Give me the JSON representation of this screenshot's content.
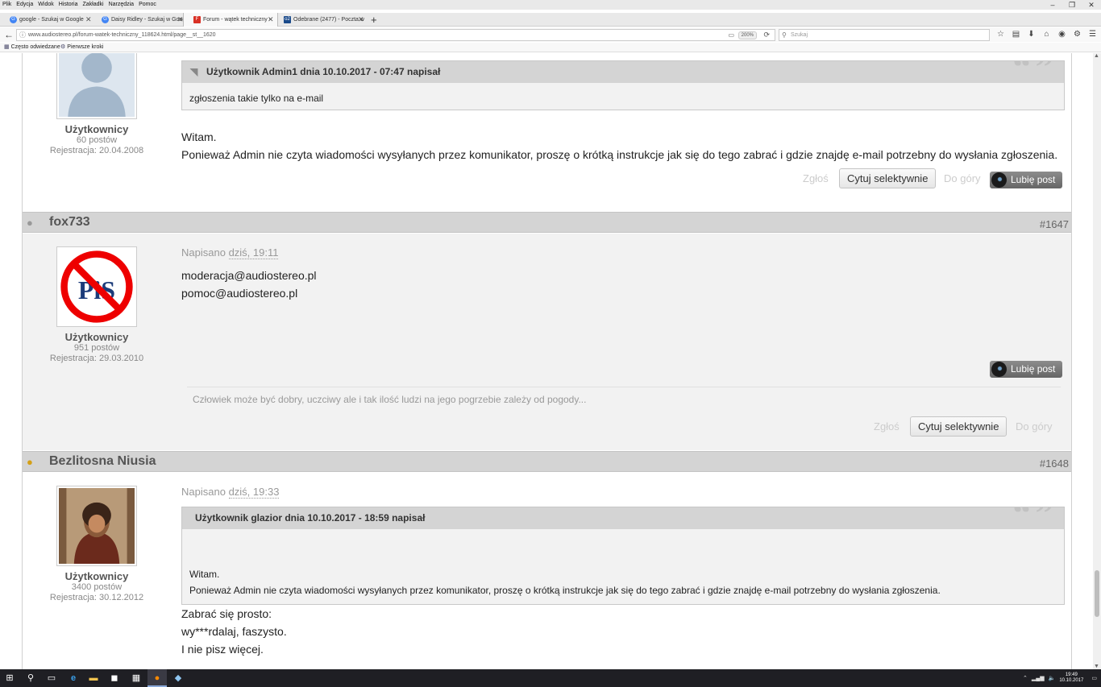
{
  "menubar": [
    "Plik",
    "Edycja",
    "Widok",
    "Historia",
    "Zakładki",
    "Narzędzia",
    "Pomoc"
  ],
  "window_controls": {
    "minimize": "–",
    "maximize": "❐",
    "close": "✕"
  },
  "tabs": [
    {
      "label": "google - Szukaj w Google",
      "icon": "G",
      "icon_color": "#4285f4"
    },
    {
      "label": "Daisy Ridley - Szukaj w Goog",
      "icon": "G",
      "icon_color": "#4285f4"
    },
    {
      "label": "Forum - wątek techniczny -",
      "icon": "F",
      "icon_color": "#d93025",
      "active": true
    },
    {
      "label": "Odebrane (2477) - Poczta w",
      "icon": "o2",
      "icon_color": "#1a4a8a"
    }
  ],
  "newtab_label": "+",
  "url": "www.audiostereo.pl/forum-watek-techniczny_118624.html/page__st__1620",
  "zoom": "200%",
  "search_placeholder": "Szukaj",
  "toolbar_icons": [
    "☆",
    "▤",
    "⬇",
    "⌂",
    "◉",
    "⚙",
    "☰"
  ],
  "bookmarks": [
    {
      "label": "Często odwiedzane"
    },
    {
      "label": "Pierwsze kroki"
    }
  ],
  "posts": {
    "p1": {
      "group": "Użytkownicy",
      "posts": "60 postów",
      "reg": "Rejestracja: 20.04.2008",
      "quote_head": "Użytkownik Admin1 dnia 10.10.2017 - 07:47 napisał",
      "quote_body": "zgłoszenia takie tylko na e-mail",
      "lines": [
        "Witam.",
        "Ponieważ Admin nie czyta wiadomości wysyłanych przez komunikator, proszę o krótką instrukcje jak się do tego zabrać i gdzie znajdę e-mail potrzebny do wysłania zgłoszenia."
      ],
      "report": "Zgłoś",
      "quote_btn": "Cytuj selektywnie",
      "top": "Do góry",
      "like": "Lubię post"
    },
    "p2": {
      "username": "fox733",
      "number": "#1647",
      "group": "Użytkownicy",
      "posts": "951 postów",
      "reg": "Rejestracja: 29.03.2010",
      "date_prefix": "Napisano",
      "date": "dziś, 19:11",
      "lines": [
        "moderacja@audiostereo.pl",
        "pomoc@audiostereo.pl"
      ],
      "like": "Lubię post",
      "signature": "Człowiek może być dobry, uczciwy ale i tak ilość ludzi na jego pogrzebie zależy od pogody...",
      "report": "Zgłoś",
      "quote_btn": "Cytuj selektywnie",
      "top": "Do góry"
    },
    "p3": {
      "username": "Bezlitosna Niusia",
      "number": "#1648",
      "group": "Użytkownicy",
      "posts": "3400 postów",
      "reg": "Rejestracja: 30.12.2012",
      "date_prefix": "Napisano",
      "date": "dziś, 19:33",
      "quote_head": "Użytkownik glazior dnia 10.10.2017 - 18:59 napisał",
      "quote_lines": [
        "Witam.",
        "Ponieważ Admin nie czyta wiadomości wysyłanych przez komunikator, proszę o krótką instrukcje jak się do tego zabrać i gdzie znajdę e-mail potrzebny do wysłania zgłoszenia."
      ],
      "lines": [
        "Zabrać się prosto:",
        "wy***rdalaj, faszysto.",
        "I nie pisz więcej."
      ]
    }
  },
  "quote_mark": "“ ”",
  "clock": {
    "time": "19:49",
    "date": "10.10.2017"
  }
}
